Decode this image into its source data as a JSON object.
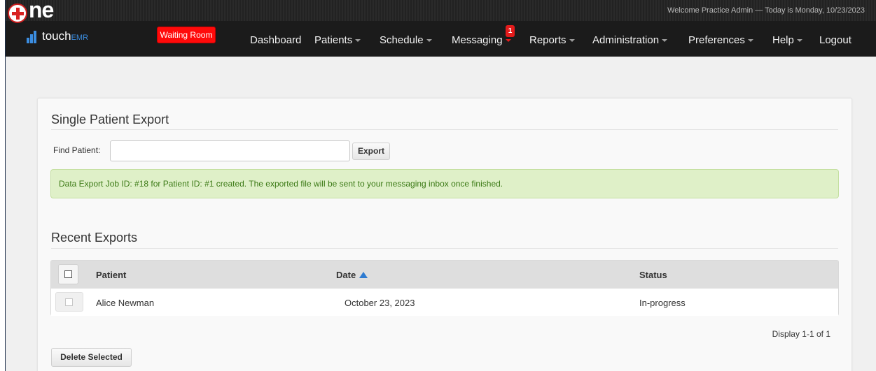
{
  "header": {
    "welcome": "Welcome Practice Admin — Today is Monday, 10/23/2023",
    "logo_main": "ne",
    "logo_touch": "touch",
    "logo_emr": "EMR",
    "waiting_room": "Waiting Room",
    "nav": {
      "dashboard": "Dashboard",
      "patients": "Patients",
      "schedule": "Schedule",
      "messaging": "Messaging",
      "messaging_badge": "1",
      "reports": "Reports",
      "administration": "Administration",
      "preferences": "Preferences",
      "help": "Help",
      "logout": "Logout"
    }
  },
  "single_export": {
    "title": "Single Patient Export",
    "find_label": "Find Patient:",
    "find_value": "",
    "export_button": "Export",
    "alert": "Data Export Job ID: #18 for Patient ID: #1 created. The exported file will be sent to your messaging inbox once finished."
  },
  "recent_exports": {
    "title": "Recent Exports",
    "columns": {
      "patient": "Patient",
      "date": "Date",
      "status": "Status"
    },
    "rows": [
      {
        "patient": "Alice Newman",
        "date": "October 23, 2023",
        "status": "In-progress"
      }
    ],
    "display_count": "Display 1-1 of 1",
    "delete_button": "Delete Selected"
  },
  "colors": {
    "topbar": "#1b1b1b",
    "waiting_room": "#ff0a0a",
    "alert_bg": "#dff0c8",
    "alert_text": "#3c7a16",
    "sort_arrow": "#2e7bd1"
  }
}
